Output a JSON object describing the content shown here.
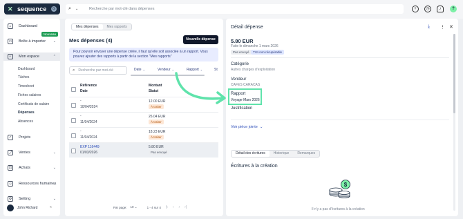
{
  "topbar": {
    "brand": "sequence",
    "brand_badge": "G",
    "search_placeholder": "Recherche par mot-clé dans dépenses",
    "avatar_letter": "?"
  },
  "sidebar": {
    "items": [
      {
        "label": "Dashboard"
      },
      {
        "label": "Boîte à importer"
      },
      {
        "label": "Mon espace"
      },
      {
        "label": "Projets"
      },
      {
        "label": "Ventes"
      },
      {
        "label": "Achats"
      },
      {
        "label": "Ressources humaines"
      },
      {
        "label": "Setting"
      }
    ],
    "new_badge": "Nouveau",
    "sub_items": [
      {
        "label": "Dashboard"
      },
      {
        "label": "Tâches"
      },
      {
        "label": "Timesheet"
      },
      {
        "label": "Fiches salaires"
      },
      {
        "label": "Certificats de salaire"
      },
      {
        "label": "Dépenses"
      },
      {
        "label": "Absences"
      }
    ],
    "user_name": "John Richard"
  },
  "main": {
    "tabs": [
      {
        "label": "Mes dépenses"
      },
      {
        "label": "Mes rapports"
      }
    ],
    "title": "Mes dépenses (4)",
    "new_button": "Nouvelle dépense",
    "info": "Pour pouvoir envoyer une dépense créée, il faut qu'elle soit associée à un rapport. Vous pouvez ajouter des rapports à partir de la section \"Mes rapports\"",
    "search_placeholder": "Recherche par mot-clé",
    "filters": [
      "Date",
      "Vendeur",
      "Rapport",
      "St"
    ],
    "columns": {
      "ref": "Référence",
      "date": "Date",
      "amount": "Montant",
      "status": "Statut"
    },
    "rows": [
      {
        "ref": "-",
        "date": "10/04/2024",
        "amount": "12.00 EUR",
        "status": "À traiter"
      },
      {
        "ref": "-",
        "date": "11/04/2024",
        "amount": "26.04 EUR",
        "status": "À traiter"
      },
      {
        "ref": "-",
        "date": "11/04/2024",
        "amount": "18.23 EUR",
        "status": "À traiter"
      },
      {
        "ref": "EXP 116449",
        "date": "01/03/2026",
        "amount": "5.80 EUR",
        "status": "Pas envoyé"
      }
    ],
    "pager": {
      "per_page_label": "Par page:",
      "per_page_value": "10",
      "range": "1 - 4 sur 4"
    }
  },
  "detail": {
    "title": "Détail dépense",
    "amount": "5.80 EUR",
    "date_line": "Fuite le dimanche 1 mars 2026",
    "badges": [
      "Pas envoyé",
      "TVA non récupérable"
    ],
    "category_label": "Catégorie",
    "category_value": "Autres charges d'exploitation",
    "vendor_label": "Vendeur",
    "vendor_value": "CAFES CARACAS",
    "report_label": "Rapport",
    "report_value": "Voyage Mars 2026",
    "justification_label": "Justification",
    "attachment_link": "Voir pièce jointe",
    "tabs": [
      "Détail des écritures",
      "Historique",
      "Remarques"
    ],
    "section_title": "Écritures à la création",
    "empty_text": "Il n'y a pas d'écritures à la création"
  },
  "colors": {
    "brand_dark": "#1a2a3f",
    "accent_blue": "#2a4bb8",
    "highlight_green": "#5fe3ab",
    "status_todo": "#b45a12"
  }
}
